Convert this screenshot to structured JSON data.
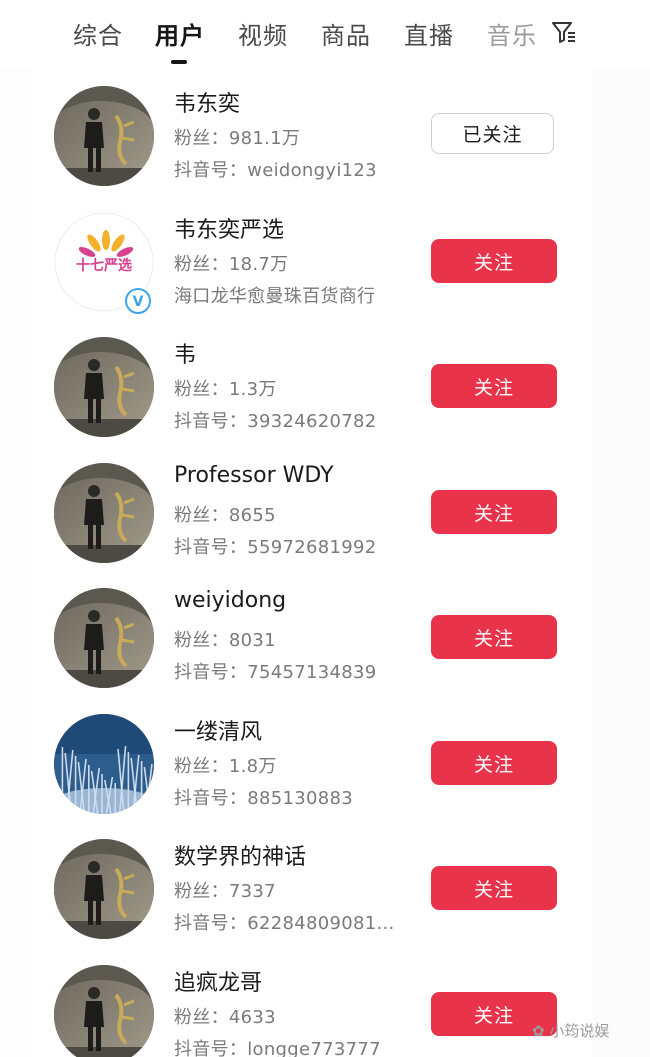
{
  "tabs": [
    {
      "label": "综合"
    },
    {
      "label": "用户"
    },
    {
      "label": "视频"
    },
    {
      "label": "商品"
    },
    {
      "label": "直播"
    },
    {
      "label": "音乐"
    }
  ],
  "active_tab": "用户",
  "filter_icon": "filter-icon",
  "fans_prefix": "粉丝：",
  "douyin_prefix": "抖音号：",
  "users": [
    {
      "name": "韦东奕",
      "fans": "981.1万",
      "douyin_id": "weidongyi123",
      "button": "已关注",
      "avatar": "stone-photo"
    },
    {
      "name": "韦东奕严选",
      "fans": "18.7万",
      "detail": "海口龙华愈曼珠百货商行",
      "button": "关注",
      "avatar": "shop-logo",
      "logo_text": "十七严选",
      "verified_badge": "V"
    },
    {
      "name": "韦",
      "fans": "1.3万",
      "douyin_id": "39324620782",
      "button": "关注",
      "avatar": "stone-photo"
    },
    {
      "name": "Professor WDY",
      "fans": "8655",
      "douyin_id": "55972681992",
      "button": "关注",
      "avatar": "stone-photo"
    },
    {
      "name": "weiyidong",
      "fans": "8031",
      "douyin_id": "75457134839",
      "button": "关注",
      "avatar": "stone-photo"
    },
    {
      "name": "一缕清风",
      "fans": "1.8万",
      "douyin_id": "885130883",
      "button": "关注",
      "avatar": "frost-photo"
    },
    {
      "name": "数学界的神话",
      "fans": "7337",
      "douyin_id": "62284809081...",
      "button": "关注",
      "avatar": "stone-photo"
    },
    {
      "name": "追疯龙哥",
      "fans": "4633",
      "douyin_id": "longge773777",
      "button": "关注",
      "avatar": "stone-photo"
    }
  ],
  "watermark": "小筠说娱",
  "colors": {
    "follow_button": "#e8334b",
    "text_primary": "#1b1b1b",
    "text_secondary": "#7a7a7a"
  }
}
